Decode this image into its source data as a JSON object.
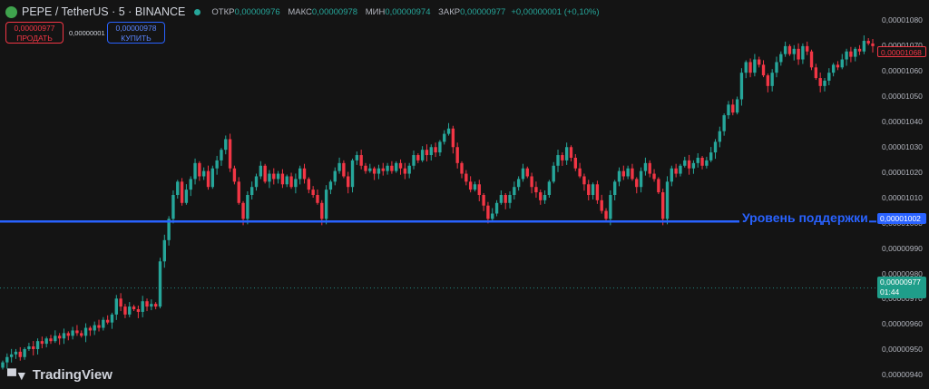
{
  "header": {
    "symbol": "PEPE / TetherUS · 5 · BINANCE",
    "open_label": "ОТКР",
    "open": "0,00000976",
    "high_label": "МАКС",
    "high": "0,00000978",
    "low_label": "МИН",
    "low": "0,00000974",
    "close_label": "ЗАКР",
    "close": "0,00000977",
    "change": "+0,00000001 (+0,10%)"
  },
  "trade": {
    "sell_price": "0,00000977",
    "sell_label": "ПРОДАТЬ",
    "spread": "0,00000001",
    "buy_price": "0,00000978",
    "buy_label": "КУПИТЬ"
  },
  "price_axis": {
    "ticks": [
      "0,00001080",
      "0,00001070",
      "0,00001060",
      "0,00001050",
      "0,00001040",
      "0,00001030",
      "0,00001020",
      "0,00001010",
      "0,00001000",
      "0,00000990",
      "0,00000980",
      "0,00000970",
      "0,00000960",
      "0,00000950",
      "0,00000940"
    ]
  },
  "tags": {
    "high_price": "0,00001068",
    "support_price": "0,00001002",
    "last_price": "0,00000977",
    "countdown": "01:44"
  },
  "annotation": {
    "support_text": "Уровень поддержки"
  },
  "branding": {
    "logo_text": "TradingView"
  },
  "colors": {
    "up": "#26a69a",
    "down": "#f23645",
    "support": "#2962ff",
    "background": "#141414"
  },
  "chart_data": {
    "type": "candlestick",
    "y_min": 9.4e-06,
    "y_max": 1.084e-05,
    "support_level": 1.002e-05,
    "last_price": 9.77e-06,
    "close_series": [
      9.49e-06,
      9.51e-06,
      9.52e-06,
      9.53e-06,
      9.51e-06,
      9.54e-06,
      9.55e-06,
      9.54e-06,
      9.57e-06,
      9.56e-06,
      9.58e-06,
      9.57e-06,
      9.59e-06,
      9.58e-06,
      9.6e-06,
      9.59e-06,
      9.61e-06,
      9.6e-06,
      9.59e-06,
      9.62e-06,
      9.61e-06,
      9.63e-06,
      9.62e-06,
      9.65e-06,
      9.64e-06,
      9.67e-06,
      9.73e-06,
      9.7e-06,
      9.67e-06,
      9.7e-06,
      9.69e-06,
      9.68e-06,
      9.72e-06,
      9.7e-06,
      9.71e-06,
      9.7e-06,
      9.87e-06,
      9.95e-06,
      1.003e-05,
      1.012e-05,
      1.017e-05,
      1.009e-05,
      1.014e-05,
      1.018e-05,
      1.024e-05,
      1.019e-05,
      1.021e-05,
      1.015e-05,
      1.022e-05,
      1.025e-05,
      1.029e-05,
      1.033e-05,
      1.022e-05,
      1.017e-05,
      1.009e-05,
      1.003e-05,
      1.012e-05,
      1.015e-05,
      1.019e-05,
      1.023e-05,
      1.017e-05,
      1.02e-05,
      1.018e-05,
      1.02e-05,
      1.016e-05,
      1.019e-05,
      1.015e-05,
      1.018e-05,
      1.022e-05,
      1.018e-05,
      1.014e-05,
      1.012e-05,
      1.009e-05,
      1.003e-05,
      1.014e-05,
      1.017e-05,
      1.021e-05,
      1.024e-05,
      1.019e-05,
      1.015e-05,
      1.025e-05,
      1.027e-05,
      1.023e-05,
      1.021e-05,
      1.022e-05,
      1.02e-05,
      1.022e-05,
      1.021e-05,
      1.023e-05,
      1.021e-05,
      1.024e-05,
      1.022e-05,
      1.02e-05,
      1.023e-05,
      1.027e-05,
      1.025e-05,
      1.029e-05,
      1.027e-05,
      1.03e-05,
      1.028e-05,
      1.032e-05,
      1.035e-05,
      1.037e-05,
      1.03e-05,
      1.024e-05,
      1.02e-05,
      1.017e-05,
      1.014e-05,
      1.016e-05,
      1.012e-05,
      1.008e-05,
      1.003e-05,
      1.005e-05,
      1.009e-05,
      1.012e-05,
      1.009e-05,
      1.012e-05,
      1.015e-05,
      1.018e-05,
      1.022e-05,
      1.019e-05,
      1.015e-05,
      1.013e-05,
      1.01e-05,
      1.012e-05,
      1.017e-05,
      1.023e-05,
      1.027e-05,
      1.025e-05,
      1.03e-05,
      1.026e-05,
      1.022e-05,
      1.019e-05,
      1.016e-05,
      1.012e-05,
      1.016e-05,
      1.01e-05,
      1.006e-05,
      1.003e-05,
      1.012e-05,
      1.017e-05,
      1.021e-05,
      1.019e-05,
      1.022e-05,
      1.018e-05,
      1.015e-05,
      1.021e-05,
      1.024e-05,
      1.02e-05,
      1.018e-05,
      1.013e-05,
      1.003e-05,
      1.017e-05,
      1.022e-05,
      1.02e-05,
      1.023e-05,
      1.025e-05,
      1.022e-05,
      1.024e-05,
      1.026e-05,
      1.023e-05,
      1.025e-05,
      1.028e-05,
      1.032e-05,
      1.036e-05,
      1.042e-05,
      1.046e-05,
      1.043e-05,
      1.048e-05,
      1.058e-05,
      1.062e-05,
      1.058e-05,
      1.063e-05,
      1.061e-05,
      1.057e-05,
      1.053e-05,
      1.058e-05,
      1.062e-05,
      1.065e-05,
      1.068e-05,
      1.065e-05,
      1.067e-05,
      1.063e-05,
      1.068e-05,
      1.066e-05,
      1.06e-05,
      1.056e-05,
      1.053e-05,
      1.055e-05,
      1.058e-05,
      1.061e-05,
      1.06e-05,
      1.063e-05,
      1.066e-05,
      1.064e-05,
      1.067e-05,
      1.066e-05,
      1.07e-05,
      1.069e-05,
      1.068e-05
    ]
  }
}
